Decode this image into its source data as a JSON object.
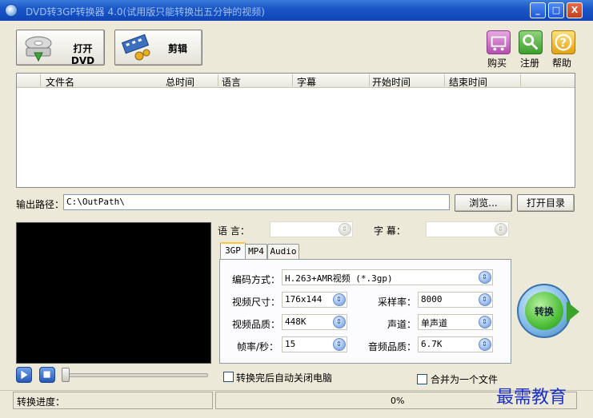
{
  "window": {
    "title": "DVD转3GP转换器 4.0(试用版只能转换出五分钟的视频)",
    "minimize": "_",
    "maximize": "□",
    "close": "X"
  },
  "toolbar": {
    "open_dvd_label": "打开DVD",
    "edit_label": "剪辑",
    "buy_label": "购买",
    "register_label": "注册",
    "help_label": "帮助"
  },
  "file_table": {
    "columns": [
      "文件名",
      "总时间",
      "语言",
      "字幕",
      "开始时间",
      "结束时间"
    ],
    "rows": []
  },
  "output": {
    "label": "输出路径：",
    "path": "C:\\OutPath\\",
    "browse_label": "浏览...",
    "open_dir_label": "打开目录"
  },
  "audio_sub": {
    "language_label": "语    言：",
    "language_value": "",
    "subtitle_label": "字    幕：",
    "subtitle_value": ""
  },
  "tabs": [
    "3GP",
    "MP4",
    "Audio"
  ],
  "settings": {
    "encoding_label": "编码方式：",
    "encoding_value": "H.263+AMR视频 (*.3gp)",
    "video_size_label": "视频尺寸：",
    "video_size_value": "176x144",
    "video_quality_label": "视频品质：",
    "video_quality_value": "448K",
    "frame_rate_label": "帧率/秒：",
    "frame_rate_value": "15",
    "sample_rate_label": "采样率：",
    "sample_rate_value": "8000",
    "channel_label": "声道：",
    "channel_value": "单声道",
    "audio_quality_label": "音频品质：",
    "audio_quality_value": "6.7K"
  },
  "convert_label": "转换",
  "options": {
    "shutdown_label": "转换完后自动关闭电脑",
    "merge_label": "合并为一个文件"
  },
  "status": {
    "progress_label": "转换进度：",
    "progress_value": "0%"
  },
  "watermark": "最需教育",
  "icons": [
    "app-icon",
    "dvd-drive-icon",
    "film-scissors-icon",
    "cart-icon",
    "key-icon",
    "question-icon",
    "play-icon",
    "stop-icon"
  ],
  "colors": {
    "titlebar": "#1b57c8",
    "convert_green": "#4fbf3a",
    "watermark": "#1a2fc8"
  }
}
